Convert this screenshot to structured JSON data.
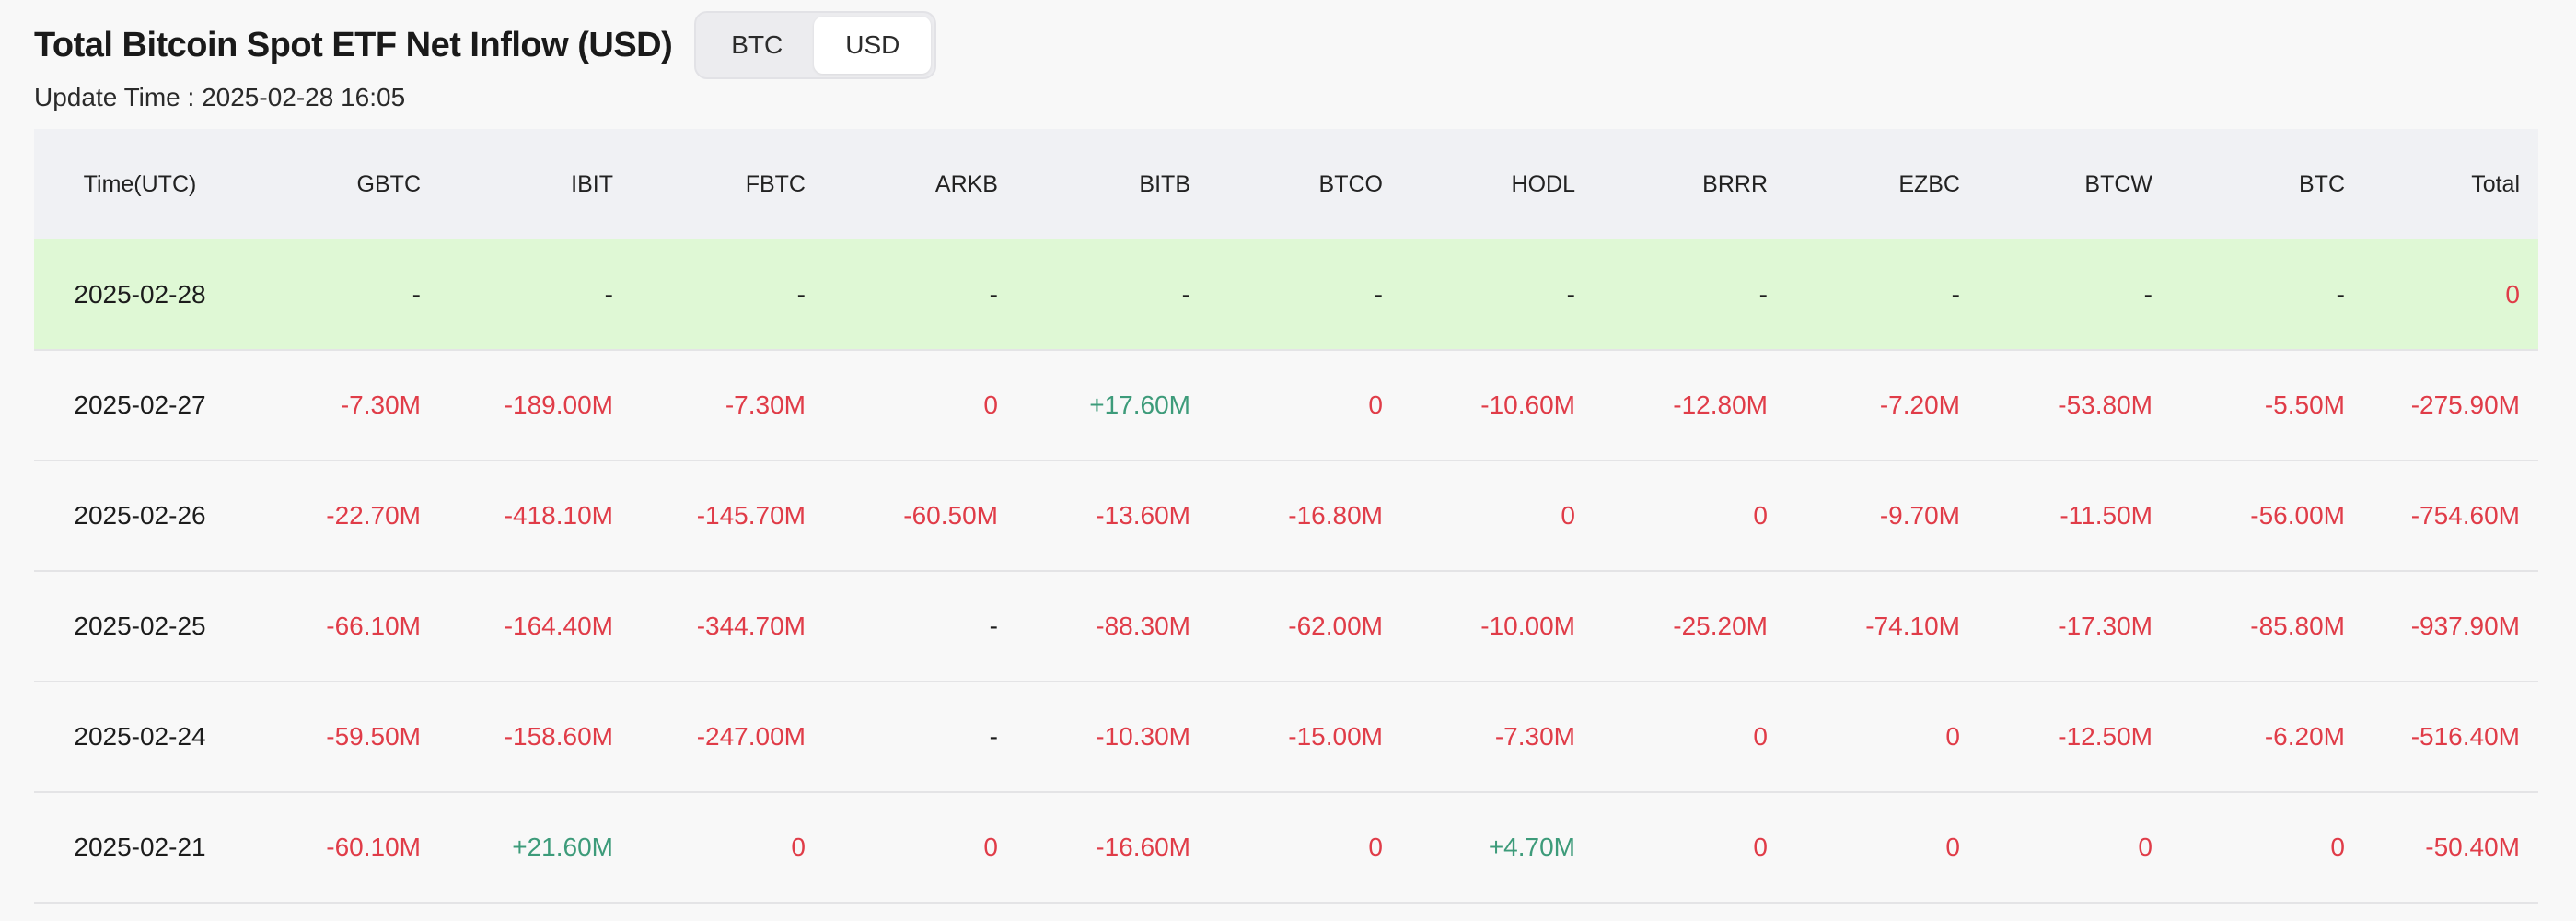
{
  "title": "Total Bitcoin Spot ETF Net Inflow (USD)",
  "toggle": {
    "options": [
      "BTC",
      "USD"
    ],
    "selected": "USD"
  },
  "update_time": "Update Time : 2025-02-28 16:05",
  "colors": {
    "negative": "#e03c48",
    "positive": "#3d9b7a",
    "highlight_row": "#dff8d5",
    "header_bg": "#f0f1f4"
  },
  "table": {
    "columns": [
      "Time(UTC)",
      "GBTC",
      "IBIT",
      "FBTC",
      "ARKB",
      "BITB",
      "BTCO",
      "HODL",
      "BRRR",
      "EZBC",
      "BTCW",
      "BTC",
      "Total"
    ],
    "rows": [
      {
        "date": "2025-02-28",
        "values": [
          "-",
          "-",
          "-",
          "-",
          "-",
          "-",
          "-",
          "-",
          "-",
          "-",
          "-",
          "0"
        ],
        "highlight": true
      },
      {
        "date": "2025-02-27",
        "values": [
          "-7.30M",
          "-189.00M",
          "-7.30M",
          "0",
          "+17.60M",
          "0",
          "-10.60M",
          "-12.80M",
          "-7.20M",
          "-53.80M",
          "-5.50M",
          "-275.90M"
        ]
      },
      {
        "date": "2025-02-26",
        "values": [
          "-22.70M",
          "-418.10M",
          "-145.70M",
          "-60.50M",
          "-13.60M",
          "-16.80M",
          "0",
          "0",
          "-9.70M",
          "-11.50M",
          "-56.00M",
          "-754.60M"
        ]
      },
      {
        "date": "2025-02-25",
        "values": [
          "-66.10M",
          "-164.40M",
          "-344.70M",
          "-",
          "-88.30M",
          "-62.00M",
          "-10.00M",
          "-25.20M",
          "-74.10M",
          "-17.30M",
          "-85.80M",
          "-937.90M"
        ]
      },
      {
        "date": "2025-02-24",
        "values": [
          "-59.50M",
          "-158.60M",
          "-247.00M",
          "-",
          "-10.30M",
          "-15.00M",
          "-7.30M",
          "0",
          "0",
          "-12.50M",
          "-6.20M",
          "-516.40M"
        ]
      },
      {
        "date": "2025-02-21",
        "values": [
          "-60.10M",
          "+21.60M",
          "0",
          "0",
          "-16.60M",
          "0",
          "+4.70M",
          "0",
          "0",
          "0",
          "0",
          "-50.40M"
        ]
      }
    ]
  }
}
